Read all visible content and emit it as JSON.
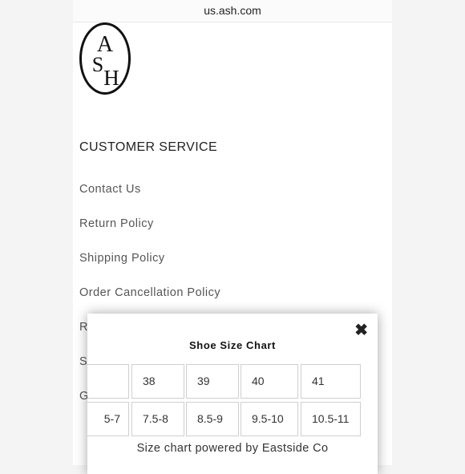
{
  "browser": {
    "url": "us.ash.com"
  },
  "brand": {
    "logo_letters": [
      "A",
      "S",
      "H"
    ],
    "logo_name": "ASH"
  },
  "customer_service": {
    "title": "CUSTOMER SERVICE",
    "links": [
      {
        "label": "Contact Us"
      },
      {
        "label": "Return Policy"
      },
      {
        "label": "Shipping Policy"
      },
      {
        "label": "Order Cancellation Policy"
      },
      {
        "label": "R"
      },
      {
        "label": "S"
      },
      {
        "label": "G"
      }
    ]
  },
  "size_chart_modal": {
    "close_icon": "close-icon",
    "title": "Shoe Size Chart",
    "rows": [
      [
        "",
        "38",
        "39",
        "40",
        "41"
      ],
      [
        "5-7",
        "7.5-8",
        "8.5-9",
        "9.5-10",
        "10.5-11"
      ]
    ],
    "footer": "Size chart powered by Eastside Co"
  }
}
